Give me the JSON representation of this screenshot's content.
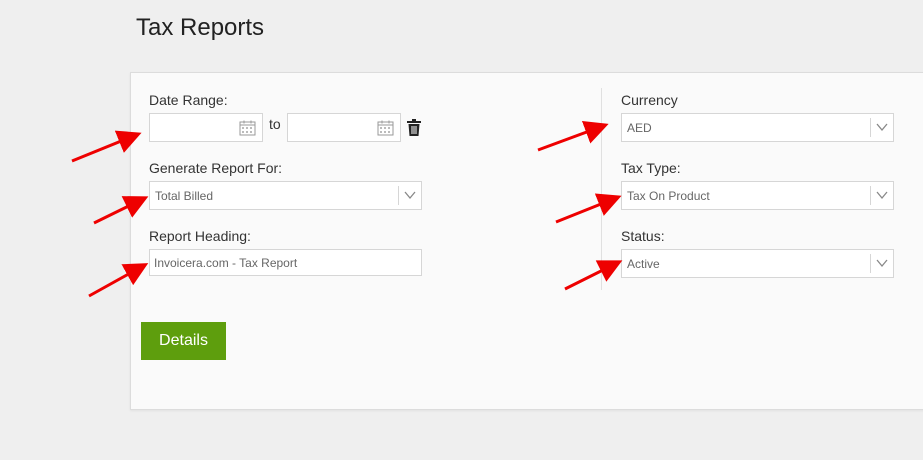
{
  "page": {
    "title": "Tax Reports"
  },
  "date_range": {
    "label": "Date Range:",
    "from_value": "",
    "to_label": "to",
    "to_value": ""
  },
  "generate_report_for": {
    "label": "Generate Report For:",
    "selected": "Total Billed"
  },
  "report_heading": {
    "label": "Report Heading:",
    "value": "Invoicera.com - Tax Report"
  },
  "currency": {
    "label": "Currency",
    "selected": "AED"
  },
  "tax_type": {
    "label": "Tax Type:",
    "selected": "Tax On Product"
  },
  "status": {
    "label": "Status:",
    "selected": "Active"
  },
  "details_button": {
    "label": "Details"
  },
  "colors": {
    "accent": "#5e9e0d",
    "annotation_arrow": "#ee0000"
  },
  "icons": [
    "calendar-icon",
    "trash-icon",
    "chevron-down-icon"
  ]
}
